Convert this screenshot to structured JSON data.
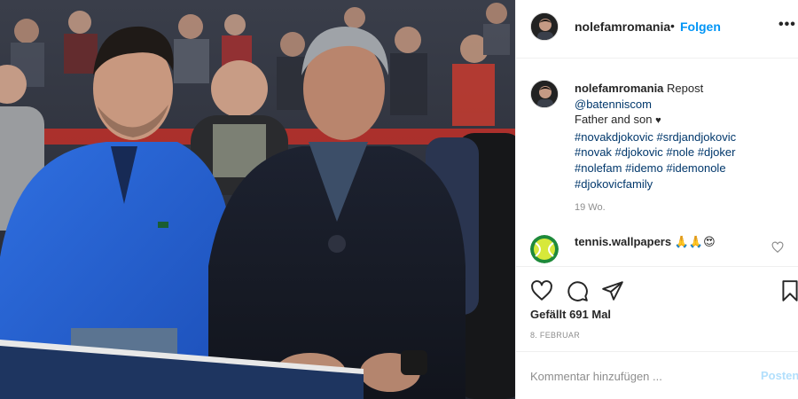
{
  "post": {
    "username": "nolefamromania",
    "dot": "•",
    "follow_label": "Folgen",
    "more_label": "•••"
  },
  "caption": {
    "username": "nolefamromania",
    "repost": "Repost",
    "mention": "@batenniscom",
    "text": "Father and son",
    "heart": "♥",
    "hashtags_line1": "#novakdjokovic #srdjandjokovic",
    "hashtags_line2": "#novak #djokovic #nole #djoker",
    "hashtags_line3": "#nolefam #idemo #idemonole",
    "hashtags_line4": "#djokovicfamily",
    "time": "19 Wo."
  },
  "comment": {
    "username": "tennis.wallpapers",
    "text": "🙏🙏😍"
  },
  "actions": {
    "likes": "Gefällt 691 Mal",
    "date": "8. Februar"
  },
  "add_comment": {
    "placeholder": "Kommentar hinzufügen ...",
    "post_label": "Posten"
  },
  "icons": {
    "like": "heart-icon",
    "comment": "comment-icon",
    "share": "paper-plane-icon",
    "save": "bookmark-icon",
    "more": "more-dots-icon"
  },
  "colors": {
    "link": "#0095f6",
    "hashtag": "#00376b",
    "muted": "#8e8e8e",
    "post_disabled": "#b2dffc"
  }
}
